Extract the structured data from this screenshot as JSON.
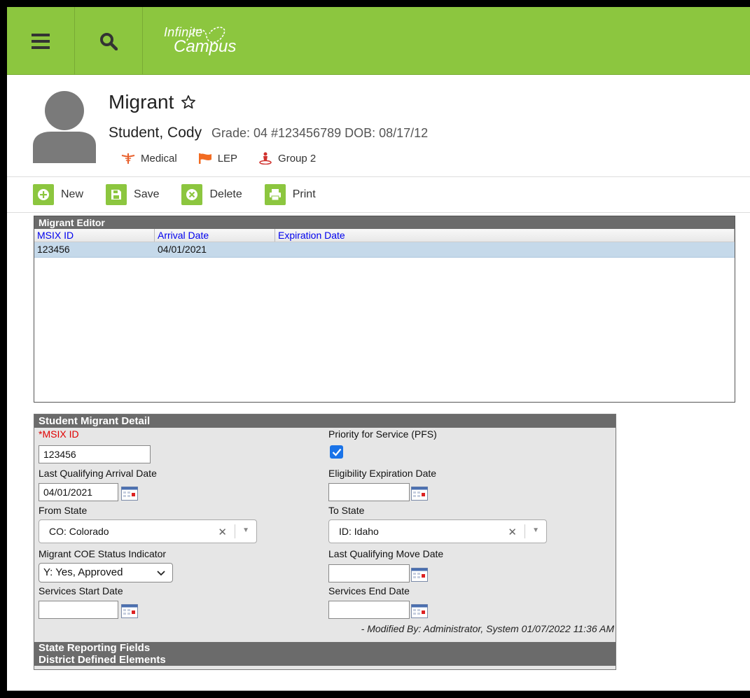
{
  "app": {
    "logo_line1": "Infinite",
    "logo_line2": "Campus"
  },
  "header": {
    "title": "Migrant",
    "student_name": "Student, Cody",
    "student_meta": "Grade: 04 #123456789 DOB: 08/17/12",
    "flags": [
      {
        "icon": "caduceus-icon",
        "label": "Medical",
        "color": "#e8602c"
      },
      {
        "icon": "flag-icon",
        "label": "LEP",
        "color": "#f26b21"
      },
      {
        "icon": "person-icon",
        "label": "Group 2",
        "color": "#d0312d"
      }
    ]
  },
  "toolbar": {
    "new_label": "New",
    "save_label": "Save",
    "delete_label": "Delete",
    "print_label": "Print"
  },
  "editor": {
    "title": "Migrant Editor",
    "columns": [
      "MSIX ID",
      "Arrival Date",
      "Expiration Date"
    ],
    "rows": [
      {
        "msix_id": "123456",
        "arrival_date": "04/01/2021",
        "expiration_date": ""
      }
    ]
  },
  "detail": {
    "title": "Student Migrant Detail",
    "msix_label": "*MSIX ID",
    "msix_value": "123456",
    "pfs_label": "Priority for Service (PFS)",
    "pfs_checked": true,
    "lq_arrival_label": "Last Qualifying Arrival Date",
    "lq_arrival_value": "04/01/2021",
    "elig_exp_label": "Eligibility Expiration Date",
    "elig_exp_value": "",
    "from_state_label": "From State",
    "from_state_value": "CO: Colorado",
    "to_state_label": "To State",
    "to_state_value": "ID: Idaho",
    "coe_label": "Migrant COE Status Indicator",
    "coe_value": "Y: Yes, Approved",
    "lq_move_label": "Last Qualifying Move Date",
    "lq_move_value": "",
    "svc_start_label": "Services Start Date",
    "svc_start_value": "",
    "svc_end_label": "Services End Date",
    "svc_end_value": "",
    "modified": "- Modified By: Administrator, System 01/07/2022 11:36 AM",
    "state_reporting": "State Reporting Fields",
    "district_defined": "District Defined Elements"
  },
  "colors": {
    "brand_green": "#8cc63f",
    "panel_header": "#6b6b6b",
    "selected_row": "#c5d9ea",
    "link_blue": "#0000ee",
    "required_red": "#e00000"
  }
}
